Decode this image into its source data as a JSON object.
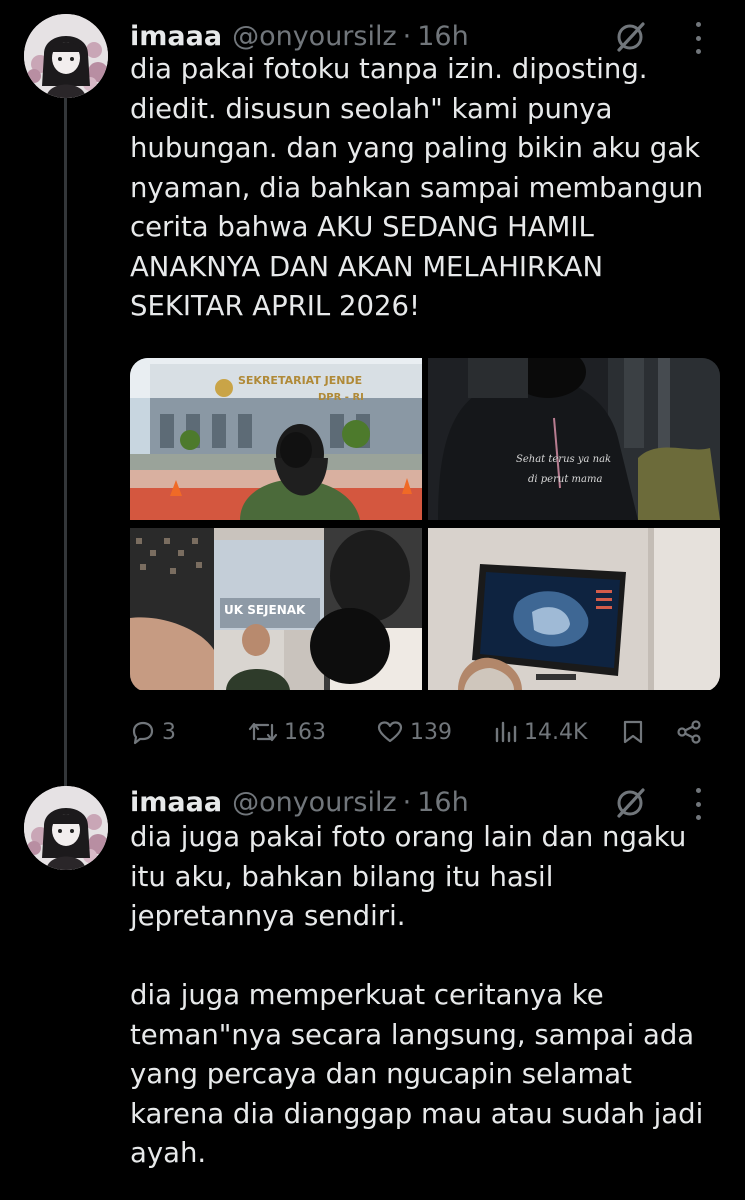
{
  "tweets": [
    {
      "name": "imaaa",
      "handle": "@onyoursilz",
      "separator": "·",
      "time": "16h",
      "text": "dia pakai fotoku tanpa izin. diposting.\ndiedit. disusun seolah\" kami punya\nhubungan. dan yang paling bikin aku gak\nnyaman, dia bahkan sampai membangun\ncerita bahwa AKU SEDANG HAMIL\nANAKNYA DAN AKAN MELAHIRKAN\nSEKITAR APRIL 2026!",
      "media": {
        "photo1_sign_line1": "SEKRETARIAT JENDE",
        "photo1_sign_line2": "DPR - RI",
        "photo2_caption_line1": "Sehat terus ya nak",
        "photo2_caption_line2": "di perut mama",
        "photo3_caption": "UK SEJENAK"
      },
      "replies": "3",
      "reposts": "163",
      "likes": "139",
      "views": "14.4K"
    },
    {
      "name": "imaaa",
      "handle": "@onyoursilz",
      "separator": "·",
      "time": "16h",
      "text": "dia juga pakai foto orang lain dan ngaku\nitu aku, bahkan bilang itu hasil\njepretannya sendiri.\n\ndia juga memperkuat ceritanya ke\nteman\"nya secara langsung, sampai ada\nyang  percaya dan ngucapin selamat\nkarena dia dianggap mau atau sudah jadi\nayah."
    }
  ],
  "colors": {
    "background": "#000000",
    "text": "#e7e9ea",
    "secondary": "#71767b",
    "thread_line": "#333639"
  },
  "icons": [
    "reply-icon",
    "repost-icon",
    "like-icon",
    "views-icon",
    "bookmark-icon",
    "share-icon",
    "grok-icon",
    "more-icon"
  ]
}
